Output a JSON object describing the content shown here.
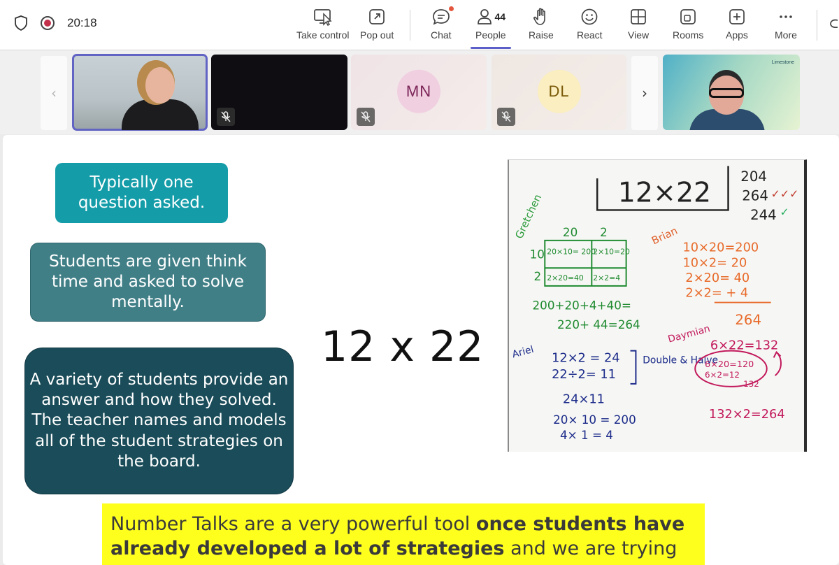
{
  "meeting": {
    "timer": "20:18"
  },
  "toolbar": {
    "take_control": "Take control",
    "pop_out": "Pop out",
    "chat": "Chat",
    "people": "People",
    "people_count": "44",
    "raise": "Raise",
    "react": "React",
    "view": "View",
    "rooms": "Rooms",
    "apps": "Apps",
    "more": "More"
  },
  "participants": [
    {
      "initials": "",
      "muted": false,
      "active_speaker": true
    },
    {
      "initials": "",
      "muted": true
    },
    {
      "initials": "MN",
      "muted": true
    },
    {
      "initials": "DL",
      "muted": true
    },
    {
      "initials": "",
      "muted": false,
      "watermark": "Limestone"
    }
  ],
  "slide": {
    "box1": "Typically one question asked.",
    "box2": "Students are given think time and asked to solve mentally.",
    "box3": "A variety of students provide an answer and how they  solved.  The teacher names  and models all of the student strategies on the board.",
    "problem": "12 x 22",
    "caption_part1": "Number Talks are a very powerful tool ",
    "caption_bold": "once students have already developed a lot of strategies",
    "caption_part2": " and we are trying to",
    "board": {
      "title": "12×22",
      "answers": [
        "204",
        "264",
        "244"
      ],
      "gretchen_label": "Gretchen",
      "brian_label": "Brian",
      "ariel_label": "Ariel",
      "daymian_label": "Daymian",
      "area_top": [
        "20",
        "2"
      ],
      "area_side": [
        "10",
        "2"
      ],
      "area_cells": [
        "20×10= 200",
        "2×10=20",
        "2×20=40",
        "2×2=4"
      ],
      "gretchen_sum1": "200+20+4+40=",
      "gretchen_sum2": "220+ 44=264",
      "brian_lines": [
        "10×20=200",
        "10×2= 20",
        "2×20= 40",
        "2×2= + 4",
        "264"
      ],
      "ariel_lines": [
        "12×2 = 24",
        "22÷2= 11",
        "24×11",
        "20× 10 = 200",
        "4× 1 = 4"
      ],
      "ariel_note": "Double & Halve",
      "daymian_lines": [
        "6×22=132",
        "6×20=120",
        "6×2=12",
        "132",
        "132×2=264"
      ]
    }
  }
}
